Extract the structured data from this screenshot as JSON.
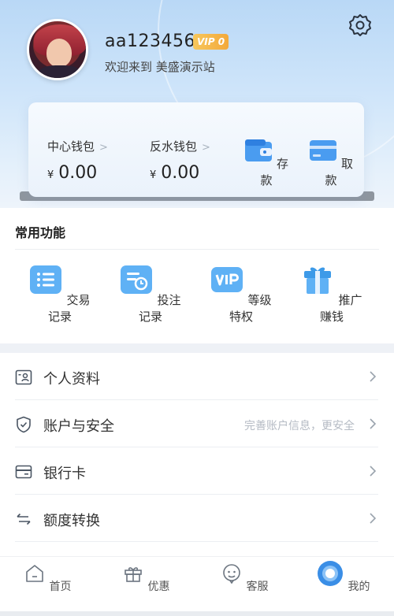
{
  "profile": {
    "username": "aa123456",
    "vip_label": "VIP 0",
    "welcome": "欢迎来到 美盛演示站"
  },
  "wallet": {
    "center_label": "中心钱包",
    "center_currency": "¥",
    "center_amount": "0.00",
    "rebate_label": "反水钱包",
    "rebate_currency": "¥",
    "rebate_amount": "0.00",
    "deposit_label": "存款",
    "withdraw_label": "取款"
  },
  "common": {
    "title": "常用功能",
    "items": [
      {
        "label": "交易记录",
        "icon": "list-icon"
      },
      {
        "label": "投注记录",
        "icon": "bet-record-icon"
      },
      {
        "label": "等级特权",
        "icon": "vip-icon"
      },
      {
        "label": "推广赚钱",
        "icon": "gift-icon"
      }
    ]
  },
  "menu": {
    "items": [
      {
        "label": "个人资料",
        "hint": "",
        "icon": "profile-card-icon"
      },
      {
        "label": "账户与安全",
        "hint": "完善账户信息，更安全",
        "icon": "shield-icon"
      },
      {
        "label": "银行卡",
        "hint": "",
        "icon": "bank-card-icon"
      },
      {
        "label": "额度转换",
        "hint": "",
        "icon": "transfer-icon"
      }
    ]
  },
  "tabbar": {
    "items": [
      {
        "label": "首页",
        "icon": "home-icon"
      },
      {
        "label": "优惠",
        "icon": "gift-box-icon"
      },
      {
        "label": "客服",
        "icon": "service-icon"
      },
      {
        "label": "我的",
        "icon": "user-icon",
        "active": true
      }
    ]
  },
  "colors": {
    "accent": "#3a8ee6",
    "header_top": "#b9d8f6",
    "vip_gold": "#f3a93b"
  }
}
